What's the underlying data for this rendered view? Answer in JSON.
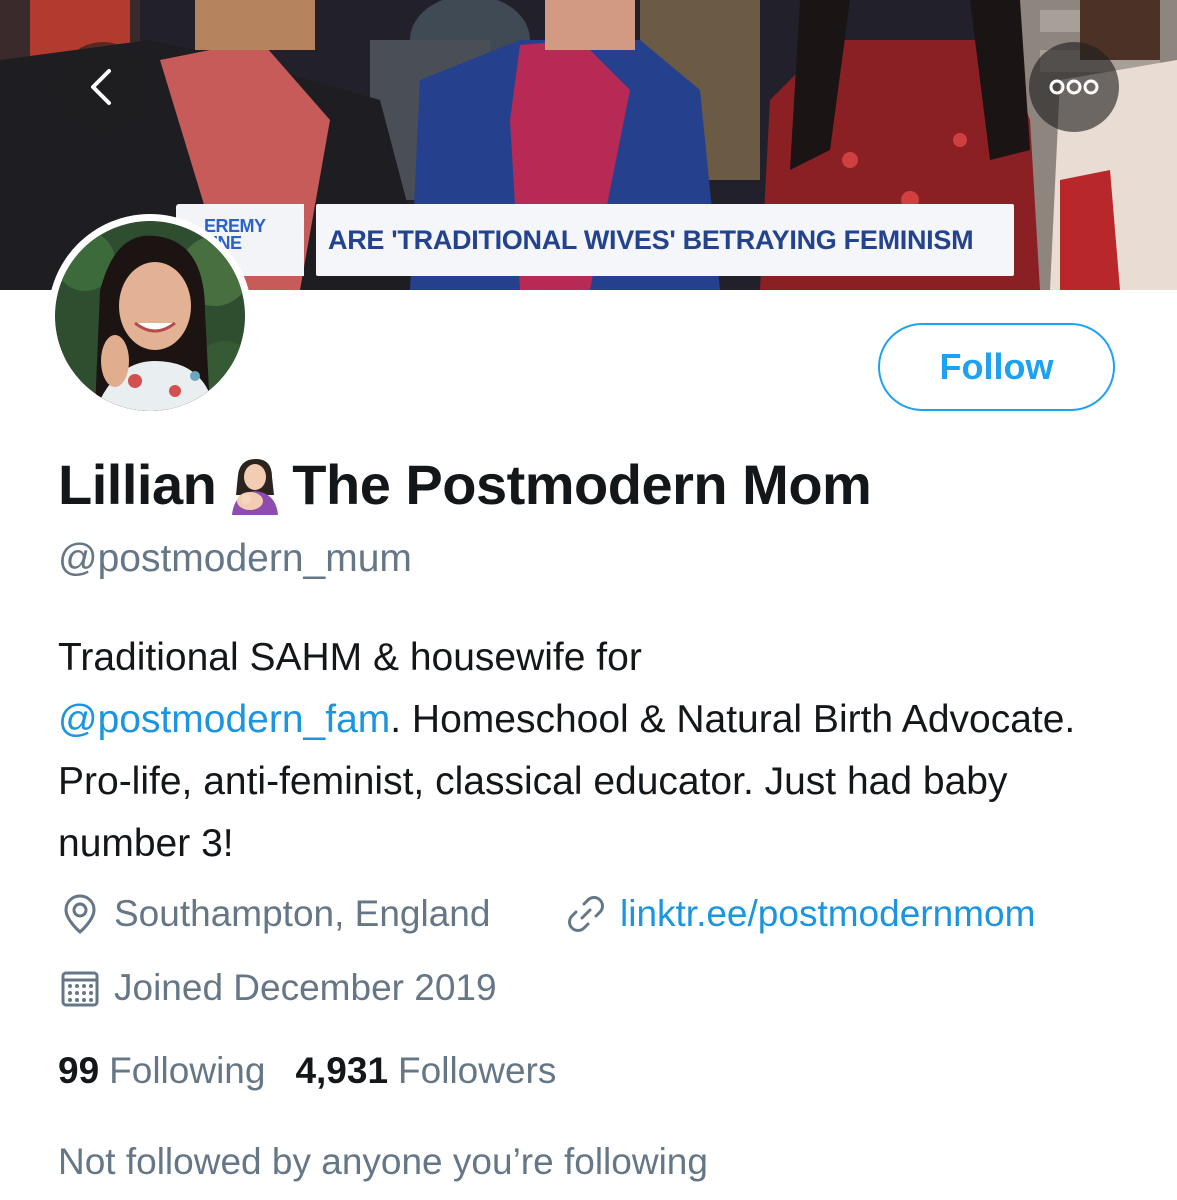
{
  "banner": {
    "show_logo_text": "EREMY\nINE",
    "headline": "ARE 'TRADITIONAL WIVES' BETRAYING FEMINISM"
  },
  "nav": {
    "back_icon": "chevron-left-icon",
    "more_icon": "ellipsis-icon"
  },
  "profile": {
    "name_first": "Lillian",
    "name_emoji": "breastfeeding-emoji",
    "name_rest": "The Postmodern Mom",
    "handle": "@postmodern_mum",
    "bio_line1": "Traditional SAHM & housewife for",
    "bio_mention": "@postmodern_fam",
    "bio_after_mention": ". Homeschool & Natural Birth Advocate. Pro-life, anti-feminist, classical educator. Just had baby number 3!",
    "location": "Southampton, England",
    "website": "linktr.ee/postmodernmom",
    "joined": "Joined December 2019"
  },
  "actions": {
    "follow_label": "Follow"
  },
  "stats": {
    "following_count": "99",
    "following_label": "Following",
    "followers_count": "4,931",
    "followers_label": "Followers"
  },
  "social_context": "Not followed by anyone you’re following",
  "colors": {
    "accent": "#1da1f2",
    "link": "#1b95e0",
    "text_primary": "#14171a",
    "text_secondary": "#657786"
  }
}
